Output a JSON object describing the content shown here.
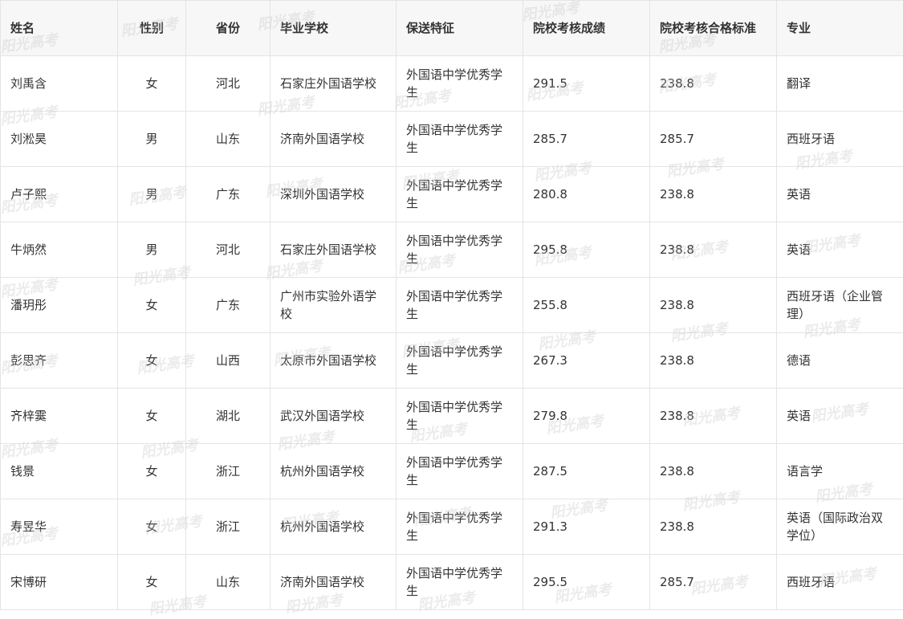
{
  "table": {
    "headers": [
      "姓名",
      "性别",
      "省份",
      "毕业学校",
      "保送特征",
      "院校考核成绩",
      "院校考核合格标准",
      "专业"
    ],
    "rows": [
      [
        "刘禹含",
        "女",
        "河北",
        "石家庄外国语学校",
        "外国语中学优秀学生",
        "291.5",
        "238.8",
        "翻译"
      ],
      [
        "刘淞昊",
        "男",
        "山东",
        "济南外国语学校",
        "外国语中学优秀学生",
        "285.7",
        "285.7",
        "西班牙语"
      ],
      [
        "卢子熙",
        "男",
        "广东",
        "深圳外国语学校",
        "外国语中学优秀学生",
        "280.8",
        "238.8",
        "英语"
      ],
      [
        "牛炳然",
        "男",
        "河北",
        "石家庄外国语学校",
        "外国语中学优秀学生",
        "295.8",
        "238.8",
        "英语"
      ],
      [
        "潘玥彤",
        "女",
        "广东",
        "广州市实验外语学校",
        "外国语中学优秀学生",
        "255.8",
        "238.8",
        "西班牙语（企业管理）"
      ],
      [
        "彭思齐",
        "女",
        "山西",
        "太原市外国语学校",
        "外国语中学优秀学生",
        "267.3",
        "238.8",
        "德语"
      ],
      [
        "齐梓霙",
        "女",
        "湖北",
        "武汉外国语学校",
        "外国语中学优秀学生",
        "279.8",
        "238.8",
        "英语"
      ],
      [
        "钱景",
        "女",
        "浙江",
        "杭州外国语学校",
        "外国语中学优秀学生",
        "287.5",
        "238.8",
        "语言学"
      ],
      [
        "寿昱华",
        "女",
        "浙江",
        "杭州外国语学校",
        "外国语中学优秀学生",
        "291.3",
        "238.8",
        "英语（国际政治双学位）"
      ],
      [
        "宋博研",
        "女",
        "山东",
        "济南外国语学校",
        "外国语中学优秀学生",
        "295.5",
        "285.7",
        "西班牙语"
      ]
    ]
  },
  "watermark": {
    "text": "阳光高考",
    "color": "#c8c8c8"
  }
}
